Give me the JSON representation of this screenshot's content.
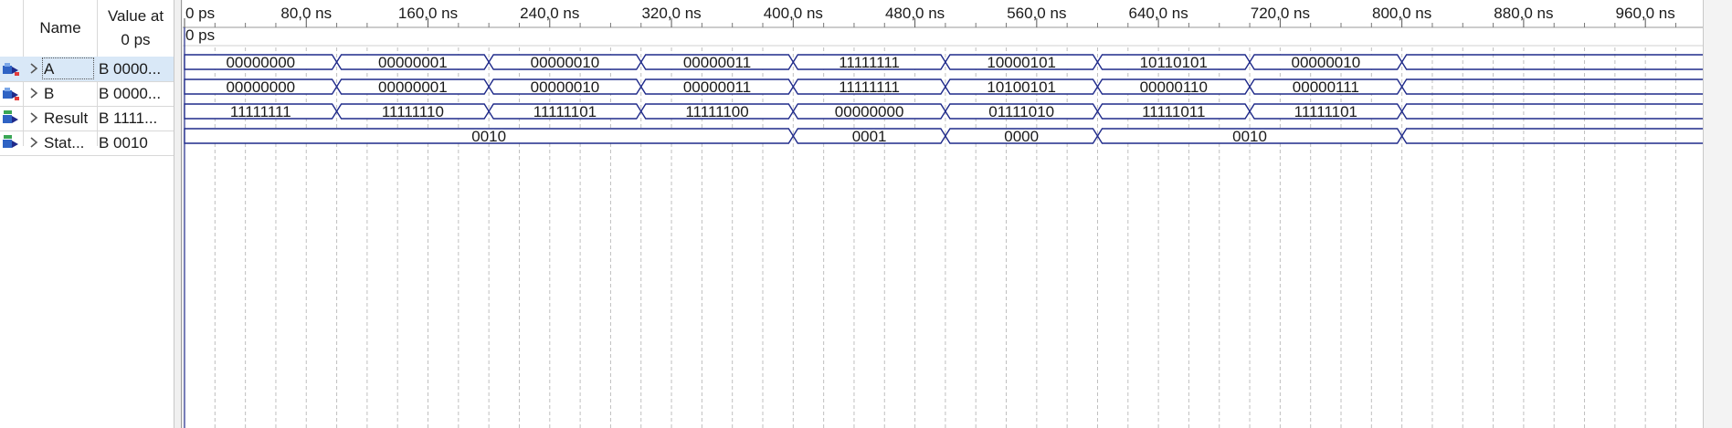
{
  "list": {
    "name_header": "Name",
    "value_header_line1": "Value at",
    "value_header_line2": "0 ps"
  },
  "signals": [
    {
      "name": "A",
      "value": "B 0000...",
      "icon": "input-port-icon",
      "selected": true
    },
    {
      "name": "B",
      "value": "B 0000...",
      "icon": "input-port-icon",
      "selected": false
    },
    {
      "name": "Result",
      "value": "B 1111...",
      "icon": "output-port-icon",
      "selected": false
    },
    {
      "name": "Stat...",
      "value": "B 0010",
      "icon": "output-port-icon",
      "selected": false
    }
  ],
  "timeline": {
    "cursor_label": "0 ps",
    "ticks": [
      "0 ps",
      "80,0 ns",
      "160,0 ns",
      "240,0 ns",
      "320,0 ns",
      "400,0 ns",
      "480,0 ns",
      "560,0 ns",
      "640,0 ns",
      "720,0 ns",
      "800,0 ns",
      "880,0 ns",
      "960,0 ns"
    ],
    "tick_step_ns": 80,
    "visible_end_ns": 1000
  },
  "waveforms": [
    {
      "signal": "A",
      "segments": [
        {
          "start": 0,
          "end": 100,
          "value": "00000000"
        },
        {
          "start": 100,
          "end": 200,
          "value": "00000001"
        },
        {
          "start": 200,
          "end": 300,
          "value": "00000010"
        },
        {
          "start": 300,
          "end": 400,
          "value": "00000011"
        },
        {
          "start": 400,
          "end": 500,
          "value": "11111111"
        },
        {
          "start": 500,
          "end": 600,
          "value": "10000101"
        },
        {
          "start": 600,
          "end": 700,
          "value": "10110101"
        },
        {
          "start": 700,
          "end": 800,
          "value": "00000010"
        }
      ]
    },
    {
      "signal": "B",
      "segments": [
        {
          "start": 0,
          "end": 100,
          "value": "00000000"
        },
        {
          "start": 100,
          "end": 200,
          "value": "00000001"
        },
        {
          "start": 200,
          "end": 300,
          "value": "00000010"
        },
        {
          "start": 300,
          "end": 400,
          "value": "00000011"
        },
        {
          "start": 400,
          "end": 500,
          "value": "11111111"
        },
        {
          "start": 500,
          "end": 600,
          "value": "10100101"
        },
        {
          "start": 600,
          "end": 700,
          "value": "00000110"
        },
        {
          "start": 700,
          "end": 800,
          "value": "00000111"
        }
      ]
    },
    {
      "signal": "Result",
      "segments": [
        {
          "start": 0,
          "end": 100,
          "value": "11111111"
        },
        {
          "start": 100,
          "end": 200,
          "value": "11111110"
        },
        {
          "start": 200,
          "end": 300,
          "value": "11111101"
        },
        {
          "start": 300,
          "end": 400,
          "value": "11111100"
        },
        {
          "start": 400,
          "end": 500,
          "value": "00000000"
        },
        {
          "start": 500,
          "end": 600,
          "value": "01111010"
        },
        {
          "start": 600,
          "end": 700,
          "value": "11111011"
        },
        {
          "start": 700,
          "end": 800,
          "value": "11111101"
        }
      ]
    },
    {
      "signal": "Status",
      "segments": [
        {
          "start": 0,
          "end": 400,
          "value": "0010"
        },
        {
          "start": 400,
          "end": 500,
          "value": "0001"
        },
        {
          "start": 500,
          "end": 600,
          "value": "0000"
        },
        {
          "start": 600,
          "end": 800,
          "value": "0010"
        }
      ]
    }
  ],
  "colors": {
    "bus": "#1f2a8a",
    "grid": "#bfbfbf",
    "selection": "#d9e8f7"
  }
}
